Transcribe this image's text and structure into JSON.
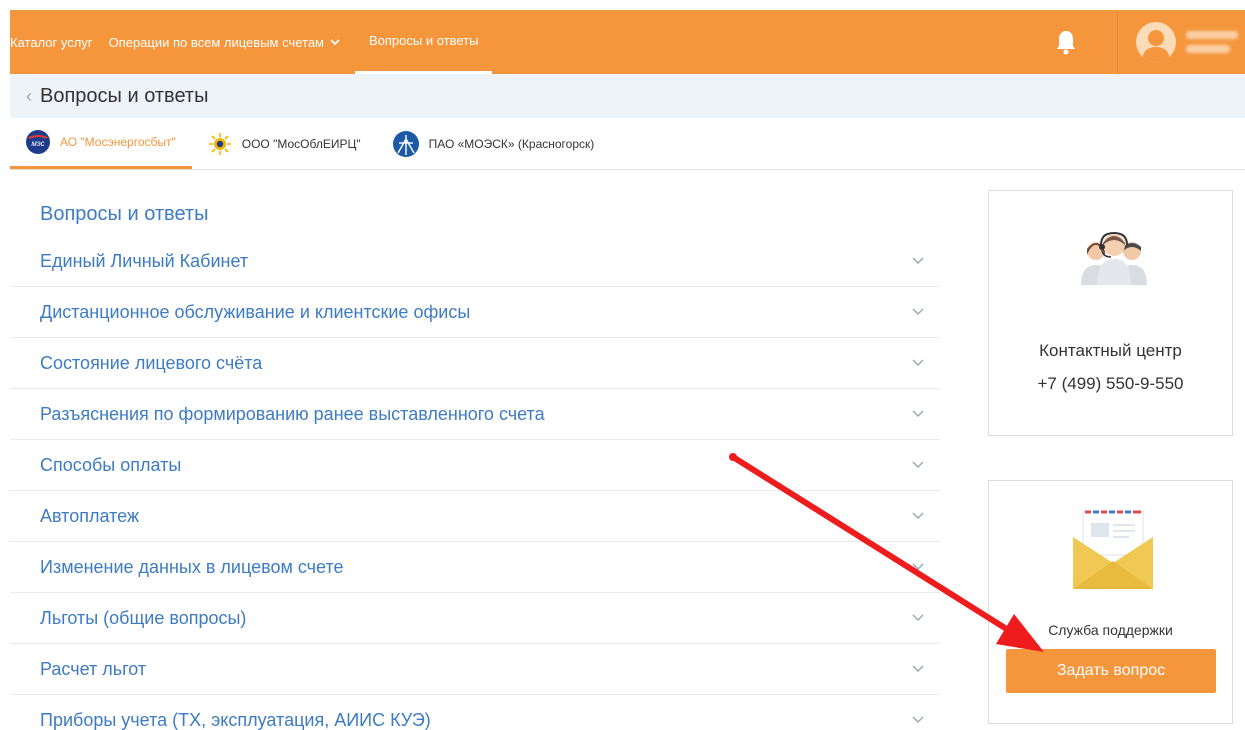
{
  "topbar": {
    "nav": [
      {
        "label": "Каталог услуг"
      },
      {
        "label": "Операции по всем лицевым счетам"
      },
      {
        "label": "Вопросы и ответы"
      }
    ]
  },
  "breadcrumb": {
    "title": "Вопросы и ответы"
  },
  "providers": [
    {
      "label": "АО \"Мосэнергосбыт\"",
      "icon_text": "мэс"
    },
    {
      "label": "ООО \"МосОблЕИРЦ\""
    },
    {
      "label": "ПАО «МОЭСК» (Красногорск)"
    }
  ],
  "faq": {
    "title": "Вопросы и ответы",
    "items": [
      "Единый Личный Кабинет",
      "Дистанционное обслуживание и клиентские офисы",
      "Состояние лицевого счёта",
      "Разъяснения по формированию ранее выставленного счета",
      "Способы оплаты",
      "Автоплатеж",
      "Изменение данных в лицевом счете",
      "Льготы (общие вопросы)",
      "Расчет льгот",
      "Приборы учета (ТХ, эксплуатация, АИИС КУЭ)"
    ]
  },
  "contact": {
    "name": "Контактный центр",
    "phone": "+7 (499) 550-9-550"
  },
  "support": {
    "label": "Служба поддержки",
    "button": "Задать вопрос"
  },
  "colors": {
    "accent": "#f5963c",
    "link": "#3d7bc4",
    "arrow": "#ee1c1c"
  }
}
